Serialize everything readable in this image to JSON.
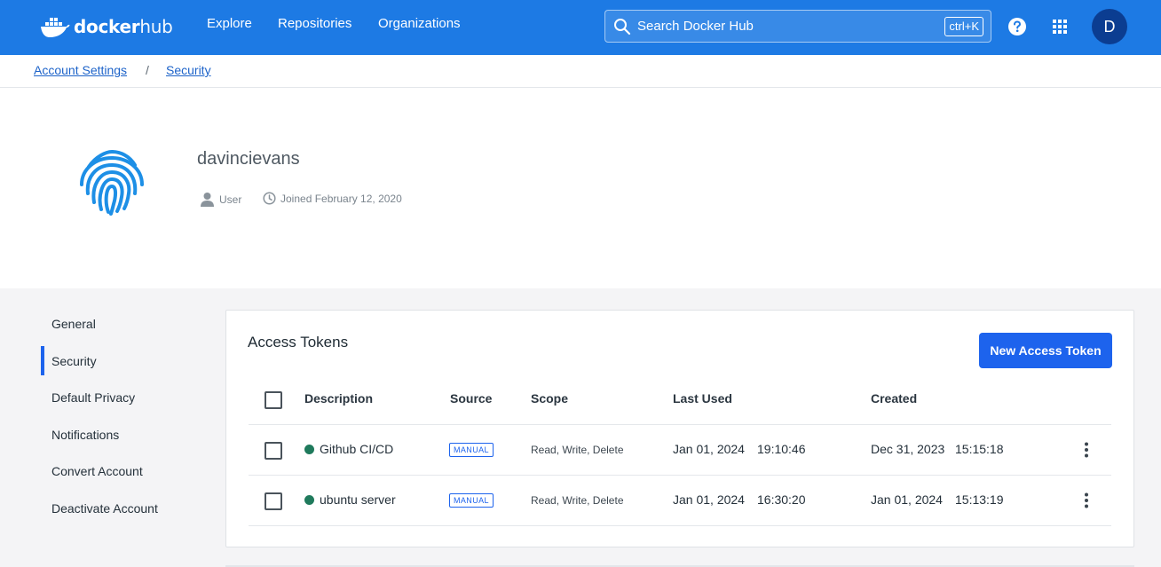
{
  "nav": {
    "logo": {
      "word1": "docker",
      "word2": "hub"
    },
    "links": [
      "Explore",
      "Repositories",
      "Organizations"
    ],
    "search": {
      "placeholder": "Search Docker Hub",
      "shortcut": "ctrl+K"
    },
    "avatar_initial": "D"
  },
  "breadcrumb": {
    "items": [
      "Account Settings",
      "Security"
    ],
    "separator": "/"
  },
  "profile": {
    "username": "davincievans",
    "role": "User",
    "joined": "Joined February 12, 2020",
    "icon": "fingerprint-icon"
  },
  "sidebar": {
    "items": [
      "General",
      "Security",
      "Default Privacy",
      "Notifications",
      "Convert Account",
      "Deactivate Account"
    ],
    "active": "Security"
  },
  "tokens": {
    "title": "Access Tokens",
    "new_button": "New Access Token",
    "columns": [
      "Description",
      "Source",
      "Scope",
      "Last Used",
      "Created"
    ],
    "rows": [
      {
        "description": "Github CI/CD",
        "source": "MANUAL",
        "scope": "Read, Write, Delete",
        "last_used_date": "Jan 01, 2024",
        "last_used_time": "19:10:46",
        "created_date": "Dec 31, 2023",
        "created_time": "15:15:18"
      },
      {
        "description": "ubuntu server",
        "source": "MANUAL",
        "scope": "Read, Write, Delete",
        "last_used_date": "Jan 01, 2024",
        "last_used_time": "16:30:20",
        "created_date": "Jan 01, 2024",
        "created_time": "15:13:19"
      }
    ]
  },
  "colors": {
    "brand_blue": "#1d7ae4",
    "button_blue": "#1d63ed",
    "active_status": "#1f7a5c"
  }
}
